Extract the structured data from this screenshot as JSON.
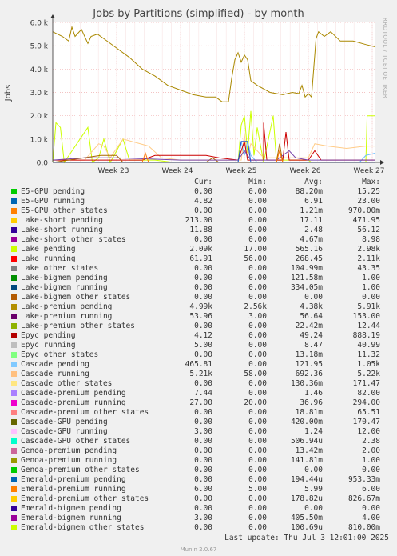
{
  "chart_data": {
    "type": "line",
    "title": "Jobs by Partitions (simplified) - by month",
    "ylabel": "Jobs",
    "ylim": [
      0,
      6000
    ],
    "yticks": [
      "0.0",
      "1.0 k",
      "2.0 k",
      "3.0 k",
      "4.0 k",
      "5.0 k",
      "6.0 k"
    ],
    "xticks": [
      "Week 23",
      "Week 24",
      "Week 25",
      "Week 26",
      "Week 27"
    ],
    "x_range_weeks": [
      22.0,
      27.05
    ],
    "grid": true,
    "series_shown": [
      {
        "name": "Lake pending",
        "color": "#ccff00",
        "points": [
          [
            22.0,
            0
          ],
          [
            22.05,
            1700
          ],
          [
            22.12,
            1500
          ],
          [
            22.18,
            0
          ],
          [
            22.55,
            1500
          ],
          [
            22.62,
            0
          ],
          [
            22.72,
            200
          ],
          [
            22.8,
            1000
          ],
          [
            22.9,
            0
          ],
          [
            23.1,
            1000
          ],
          [
            23.2,
            100
          ],
          [
            23.6,
            100
          ],
          [
            23.9,
            0
          ],
          [
            24.9,
            0
          ],
          [
            24.95,
            1600
          ],
          [
            25.0,
            2000
          ],
          [
            25.05,
            400
          ],
          [
            25.1,
            2200
          ],
          [
            25.15,
            300
          ],
          [
            25.2,
            1500
          ],
          [
            25.3,
            0
          ],
          [
            25.45,
            2000
          ],
          [
            25.5,
            100
          ],
          [
            26.0,
            100
          ],
          [
            26.05,
            0
          ],
          [
            26.9,
            0
          ],
          [
            26.92,
            2000
          ],
          [
            26.96,
            2000
          ],
          [
            27.05,
            2000
          ]
        ]
      },
      {
        "name": "Lake running",
        "color": "#aa8800",
        "points": [
          [
            22.0,
            5600
          ],
          [
            22.15,
            5400
          ],
          [
            22.25,
            5200
          ],
          [
            22.3,
            5800
          ],
          [
            22.35,
            5400
          ],
          [
            22.45,
            5700
          ],
          [
            22.55,
            5100
          ],
          [
            22.6,
            5400
          ],
          [
            22.7,
            5500
          ],
          [
            22.8,
            5300
          ],
          [
            23.0,
            4900
          ],
          [
            23.2,
            4500
          ],
          [
            23.4,
            4000
          ],
          [
            23.6,
            3700
          ],
          [
            23.8,
            3300
          ],
          [
            24.0,
            3100
          ],
          [
            24.2,
            2900
          ],
          [
            24.4,
            2800
          ],
          [
            24.55,
            2800
          ],
          [
            24.65,
            2600
          ],
          [
            24.75,
            2600
          ],
          [
            24.8,
            3600
          ],
          [
            24.85,
            4400
          ],
          [
            24.9,
            4700
          ],
          [
            24.95,
            4300
          ],
          [
            25.0,
            4600
          ],
          [
            25.05,
            4400
          ],
          [
            25.1,
            3500
          ],
          [
            25.2,
            3300
          ],
          [
            25.4,
            3000
          ],
          [
            25.6,
            2900
          ],
          [
            25.75,
            3000
          ],
          [
            25.85,
            2950
          ],
          [
            25.9,
            3300
          ],
          [
            25.95,
            2800
          ],
          [
            26.0,
            2950
          ],
          [
            26.05,
            2800
          ],
          [
            26.12,
            5300
          ],
          [
            26.16,
            5600
          ],
          [
            26.25,
            5400
          ],
          [
            26.35,
            5600
          ],
          [
            26.5,
            5200
          ],
          [
            26.7,
            5200
          ],
          [
            26.9,
            5050
          ],
          [
            27.05,
            4950
          ]
        ]
      },
      {
        "name": "Cascade running",
        "color": "#ffcc88",
        "points": [
          [
            22.0,
            100
          ],
          [
            22.5,
            100
          ],
          [
            22.72,
            800
          ],
          [
            22.8,
            700
          ],
          [
            22.9,
            200
          ],
          [
            23.1,
            1000
          ],
          [
            23.5,
            700
          ],
          [
            23.7,
            200
          ],
          [
            24.0,
            100
          ],
          [
            24.95,
            100
          ],
          [
            25.0,
            1200
          ],
          [
            25.05,
            200
          ],
          [
            25.1,
            800
          ],
          [
            25.3,
            200
          ],
          [
            26.0,
            200
          ],
          [
            26.1,
            800
          ],
          [
            26.3,
            700
          ],
          [
            26.6,
            600
          ],
          [
            26.9,
            700
          ],
          [
            27.05,
            700
          ]
        ]
      },
      {
        "name": "Cascade pending",
        "color": "#66bbff",
        "points": [
          [
            22.0,
            0
          ],
          [
            24.9,
            0
          ],
          [
            24.95,
            900
          ],
          [
            25.0,
            300
          ],
          [
            25.05,
            900
          ],
          [
            25.1,
            300
          ],
          [
            25.2,
            0
          ],
          [
            26.8,
            0
          ],
          [
            26.9,
            300
          ],
          [
            27.05,
            400
          ]
        ]
      },
      {
        "name": "Epyc pending",
        "color": "#cc0000",
        "points": [
          [
            22.0,
            100
          ],
          [
            23.4,
            100
          ],
          [
            23.6,
            300
          ],
          [
            24.0,
            300
          ],
          [
            24.4,
            300
          ],
          [
            24.6,
            200
          ],
          [
            24.9,
            100
          ],
          [
            25.0,
            900
          ],
          [
            25.05,
            100
          ],
          [
            25.3,
            100
          ],
          [
            25.3,
            1700
          ],
          [
            25.35,
            100
          ],
          [
            25.6,
            100
          ],
          [
            25.65,
            1300
          ],
          [
            25.7,
            100
          ],
          [
            26.0,
            100
          ],
          [
            26.1,
            500
          ],
          [
            26.2,
            100
          ],
          [
            27.05,
            100
          ]
        ]
      },
      {
        "name": "Lake-premium pending",
        "color": "#aa6600",
        "points": [
          [
            22.0,
            0
          ],
          [
            22.75,
            300
          ],
          [
            23.0,
            300
          ],
          [
            23.1,
            0
          ],
          [
            24.4,
            0
          ],
          [
            24.5,
            200
          ],
          [
            24.6,
            0
          ],
          [
            25.5,
            0
          ],
          [
            25.55,
            800
          ],
          [
            25.6,
            0
          ],
          [
            27.05,
            0
          ]
        ]
      },
      {
        "name": "Cascade-premium running",
        "color": "#7744aa",
        "points": [
          [
            22.0,
            100
          ],
          [
            22.5,
            200
          ],
          [
            23.0,
            200
          ],
          [
            24.0,
            100
          ],
          [
            24.9,
            100
          ],
          [
            25.0,
            500
          ],
          [
            25.1,
            100
          ],
          [
            25.5,
            100
          ],
          [
            25.7,
            500
          ],
          [
            25.8,
            200
          ],
          [
            26.0,
            100
          ],
          [
            27.05,
            100
          ]
        ]
      },
      {
        "name": "Lake-short pending",
        "color": "#ff7700",
        "points": [
          [
            22.0,
            0
          ],
          [
            23.4,
            0
          ],
          [
            23.45,
            400
          ],
          [
            23.5,
            0
          ],
          [
            25.5,
            0
          ],
          [
            25.55,
            500
          ],
          [
            25.6,
            0
          ],
          [
            27.05,
            0
          ]
        ]
      },
      {
        "name": "Genoa-premium running",
        "color": "#2255cc",
        "points": [
          [
            22.0,
            0
          ],
          [
            24.9,
            0
          ],
          [
            24.95,
            900
          ],
          [
            25.05,
            900
          ],
          [
            25.1,
            0
          ],
          [
            27.05,
            0
          ]
        ]
      }
    ]
  },
  "table_header": {
    "cur": "Cur:",
    "min": "Min:",
    "avg": "Avg:",
    "max": "Max:"
  },
  "legend": [
    {
      "name": "E5-GPU pending",
      "color": "#00cc00",
      "cur": "0.00",
      "min": "0.00",
      "avg": "88.20m",
      "max": "15.25"
    },
    {
      "name": "E5-GPU running",
      "color": "#0066b3",
      "cur": "4.82",
      "min": "0.00",
      "avg": "6.91",
      "max": "23.00"
    },
    {
      "name": "E5-GPU other states",
      "color": "#ff8000",
      "cur": "0.00",
      "min": "0.00",
      "avg": "1.21m",
      "max": "970.00m"
    },
    {
      "name": "Lake-short pending",
      "color": "#ffcc00",
      "cur": "213.00",
      "min": "0.00",
      "avg": "17.11",
      "max": "471.95"
    },
    {
      "name": "Lake-short running",
      "color": "#330099",
      "cur": "11.88",
      "min": "0.00",
      "avg": "2.48",
      "max": "56.12"
    },
    {
      "name": "Lake-short other states",
      "color": "#990099",
      "cur": "0.00",
      "min": "0.00",
      "avg": "4.67m",
      "max": "8.98"
    },
    {
      "name": "Lake pending",
      "color": "#ccff00",
      "cur": "2.09k",
      "min": "17.00",
      "avg": "565.16",
      "max": "2.98k"
    },
    {
      "name": "Lake running",
      "color": "#ff0000",
      "cur": "61.91",
      "min": "56.00",
      "avg": "268.45",
      "max": "2.11k"
    },
    {
      "name": "Lake other states",
      "color": "#808080",
      "cur": "0.00",
      "min": "0.00",
      "avg": "104.99m",
      "max": "43.35"
    },
    {
      "name": "Lake-bigmem pending",
      "color": "#008f00",
      "cur": "0.00",
      "min": "0.00",
      "avg": "121.58m",
      "max": "1.00"
    },
    {
      "name": "Lake-bigmem running",
      "color": "#00487d",
      "cur": "0.00",
      "min": "0.00",
      "avg": "334.05m",
      "max": "1.00"
    },
    {
      "name": "Lake-bigmem other states",
      "color": "#b35a00",
      "cur": "0.00",
      "min": "0.00",
      "avg": "0.00",
      "max": "0.00"
    },
    {
      "name": "Lake-premium pending",
      "color": "#b38f00",
      "cur": "4.99k",
      "min": "2.56k",
      "avg": "4.38k",
      "max": "5.91k"
    },
    {
      "name": "Lake-premium running",
      "color": "#6b006b",
      "cur": "53.96",
      "min": "3.00",
      "avg": "56.64",
      "max": "153.00"
    },
    {
      "name": "Lake-premium other states",
      "color": "#8fb300",
      "cur": "0.00",
      "min": "0.00",
      "avg": "22.42m",
      "max": "12.44"
    },
    {
      "name": "Epyc pending",
      "color": "#b30000",
      "cur": "4.12",
      "min": "0.00",
      "avg": "49.24",
      "max": "888.19"
    },
    {
      "name": "Epyc running",
      "color": "#bebebe",
      "cur": "5.00",
      "min": "0.00",
      "avg": "8.47",
      "max": "40.99"
    },
    {
      "name": "Epyc other states",
      "color": "#80ff80",
      "cur": "0.00",
      "min": "0.00",
      "avg": "13.18m",
      "max": "11.32"
    },
    {
      "name": "Cascade pending",
      "color": "#80c9ff",
      "cur": "465.81",
      "min": "0.00",
      "avg": "121.95",
      "max": "1.05k"
    },
    {
      "name": "Cascade running",
      "color": "#ffc080",
      "cur": "5.21k",
      "min": "58.00",
      "avg": "692.36",
      "max": "5.22k"
    },
    {
      "name": "Cascade other states",
      "color": "#ffe680",
      "cur": "0.00",
      "min": "0.00",
      "avg": "130.36m",
      "max": "171.47"
    },
    {
      "name": "Cascade-premium pending",
      "color": "#aa80ff",
      "cur": "7.44",
      "min": "0.00",
      "avg": "1.46",
      "max": "82.00"
    },
    {
      "name": "Cascade-premium running",
      "color": "#ee00cc",
      "cur": "27.00",
      "min": "20.00",
      "avg": "36.96",
      "max": "294.00"
    },
    {
      "name": "Cascade-premium other states",
      "color": "#ff8080",
      "cur": "0.00",
      "min": "0.00",
      "avg": "18.81m",
      "max": "65.51"
    },
    {
      "name": "Cascade-GPU pending",
      "color": "#666600",
      "cur": "0.00",
      "min": "0.00",
      "avg": "420.00m",
      "max": "170.47"
    },
    {
      "name": "Cascade-GPU running",
      "color": "#ffbfff",
      "cur": "3.00",
      "min": "0.00",
      "avg": "1.24",
      "max": "12.00"
    },
    {
      "name": "Cascade-GPU other states",
      "color": "#00ffcc",
      "cur": "0.00",
      "min": "0.00",
      "avg": "506.94u",
      "max": "2.38"
    },
    {
      "name": "Genoa-premium pending",
      "color": "#cc6699",
      "cur": "0.00",
      "min": "0.00",
      "avg": "13.42m",
      "max": "2.00"
    },
    {
      "name": "Genoa-premium running",
      "color": "#999900",
      "cur": "0.00",
      "min": "0.00",
      "avg": "141.81m",
      "max": "1.00"
    },
    {
      "name": "Genoa-premium other states",
      "color": "#00cc00",
      "cur": "0.00",
      "min": "0.00",
      "avg": "0.00",
      "max": "0.00"
    },
    {
      "name": "Emerald-premium pending",
      "color": "#0066b3",
      "cur": "0.00",
      "min": "0.00",
      "avg": "194.44u",
      "max": "953.33m"
    },
    {
      "name": "Emerald-premium running",
      "color": "#ff8000",
      "cur": "6.00",
      "min": "5.00",
      "avg": "5.99",
      "max": "6.00"
    },
    {
      "name": "Emerald-premium other states",
      "color": "#ffcc00",
      "cur": "0.00",
      "min": "0.00",
      "avg": "178.82u",
      "max": "826.67m"
    },
    {
      "name": "Emerald-bigmem pending",
      "color": "#330099",
      "cur": "0.00",
      "min": "0.00",
      "avg": "0.00",
      "max": "0.00"
    },
    {
      "name": "Emerald-bigmem running",
      "color": "#990099",
      "cur": "3.00",
      "min": "0.00",
      "avg": "405.50m",
      "max": "4.00"
    },
    {
      "name": "Emerald-bigmem other states",
      "color": "#ccff00",
      "cur": "0.00",
      "min": "0.00",
      "avg": "100.69u",
      "max": "810.00m"
    }
  ],
  "last_update": "Last update: Thu Jul  3 12:01:00 2025",
  "side_credit": "RRDTOOL / TOBI OETIKER",
  "footer": "Munin 2.0.67"
}
